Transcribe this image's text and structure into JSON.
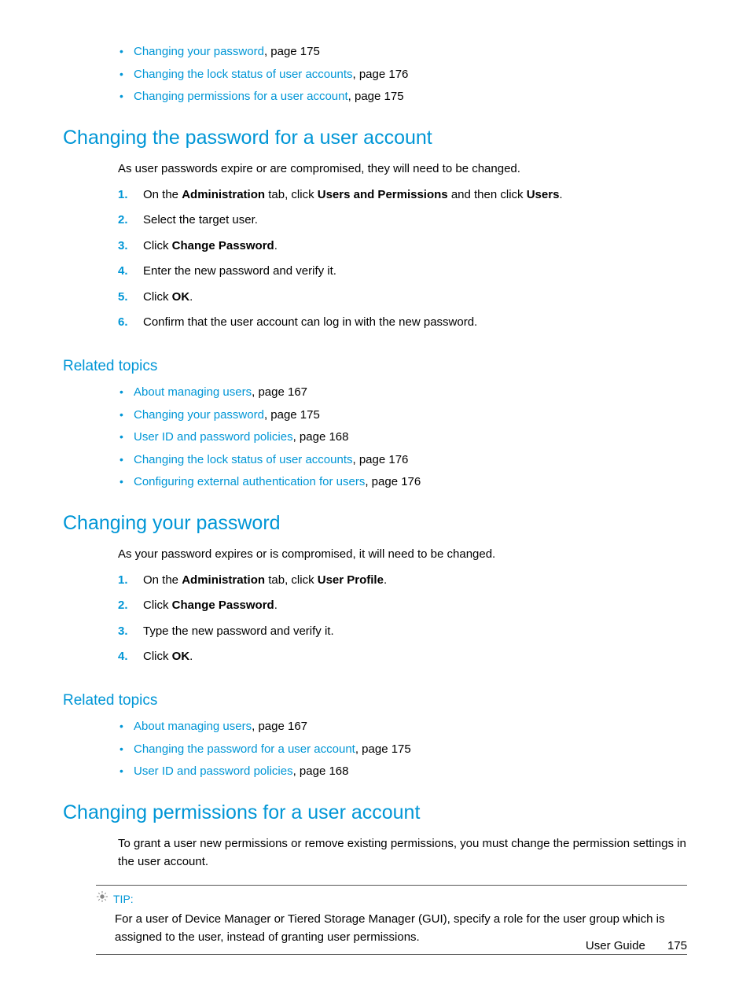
{
  "topLinks": [
    {
      "link": "Changing your password",
      "suffix": ", page 175"
    },
    {
      "link": "Changing the lock status of user accounts",
      "suffix": ", page 176"
    },
    {
      "link": "Changing permissions for a user account",
      "suffix": ", page 175"
    }
  ],
  "section1": {
    "title": "Changing the password for a user account",
    "intro": "As user passwords expire or are compromised, they will need to be changed.",
    "steps": [
      {
        "pre": "On the ",
        "b1": "Administration",
        "mid1": " tab, click ",
        "b2": "Users and Permissions",
        "mid2": " and then click ",
        "b3": "Users",
        "post": "."
      },
      {
        "pre": "Select the target user."
      },
      {
        "pre": "Click ",
        "b1": "Change Password",
        "post": "."
      },
      {
        "pre": "Enter the new password and verify it."
      },
      {
        "pre": "Click ",
        "b1": "OK",
        "post": "."
      },
      {
        "pre": "Confirm that the user account can log in with the new password."
      }
    ],
    "relatedTitle": "Related topics",
    "related": [
      {
        "link": "About managing users",
        "suffix": ", page 167"
      },
      {
        "link": "Changing your password",
        "suffix": ", page 175"
      },
      {
        "link": "User ID and password policies",
        "suffix": ", page 168"
      },
      {
        "link": "Changing the lock status of user accounts",
        "suffix": ", page 176"
      },
      {
        "link": "Configuring external authentication for users",
        "suffix": ", page 176"
      }
    ]
  },
  "section2": {
    "title": "Changing your password",
    "intro": "As your password expires or is compromised, it will need to be changed.",
    "steps": [
      {
        "pre": "On the ",
        "b1": "Administration",
        "mid1": " tab, click ",
        "b2": "User Profile",
        "post": "."
      },
      {
        "pre": "Click ",
        "b1": "Change Password",
        "post": "."
      },
      {
        "pre": "Type the new password and verify it."
      },
      {
        "pre": "Click ",
        "b1": "OK",
        "post": "."
      }
    ],
    "relatedTitle": "Related topics",
    "related": [
      {
        "link": "About managing users",
        "suffix": ", page 167"
      },
      {
        "link": "Changing the password for a user account",
        "suffix": ", page 175"
      },
      {
        "link": "User ID and password policies",
        "suffix": ", page 168"
      }
    ]
  },
  "section3": {
    "title": "Changing permissions for a user account",
    "intro": "To grant a user new permissions or remove existing permissions, you must change the permission settings in the user account.",
    "tipLabel": "TIP:",
    "tipBody": "For a user of Device Manager or Tiered Storage Manager (GUI), specify a role for the user group which is assigned to the user, instead of granting user permissions."
  },
  "footer": {
    "guide": "User Guide",
    "page": "175"
  }
}
